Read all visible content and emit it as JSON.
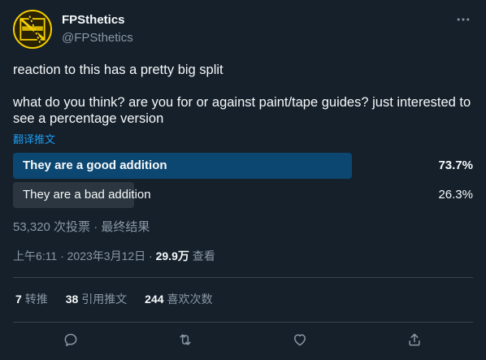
{
  "author": {
    "display_name": "FPSthetics",
    "handle": "@FPSthetics"
  },
  "more_icon": "more-horizontal-icon",
  "tweet": {
    "line1": "reaction to this has a pretty big split",
    "line2": "what do you think? are you for or against paint/tape guides? just interested to see a percentage version",
    "translate_label": "翻译推文"
  },
  "poll": {
    "options": [
      {
        "label": "They are a good addition",
        "percent_text": "73.7%",
        "percent": 73.7,
        "winner": true,
        "color": "#0c4772"
      },
      {
        "label": "They are a bad addition",
        "percent_text": "26.3%",
        "percent": 26.3,
        "winner": false,
        "color": "#2b3640"
      }
    ],
    "meta": "53,320 次投票 · 最终结果"
  },
  "timestamp": {
    "time_date": "上午6:11 · 2023年3月12日 · ",
    "views_count": "29.9万",
    "views_label": " 查看"
  },
  "stats": [
    {
      "count": "7",
      "label": "转推"
    },
    {
      "count": "38",
      "label": "引用推文"
    },
    {
      "count": "244",
      "label": "喜欢次数"
    }
  ],
  "actions": [
    "reply-icon",
    "retweet-icon",
    "like-icon",
    "share-icon"
  ],
  "colors": {
    "background": "#15202b",
    "text": "#f7f9f9",
    "secondary": "#8b98a5",
    "accent": "#1d9bf0",
    "divider": "#38444d"
  }
}
